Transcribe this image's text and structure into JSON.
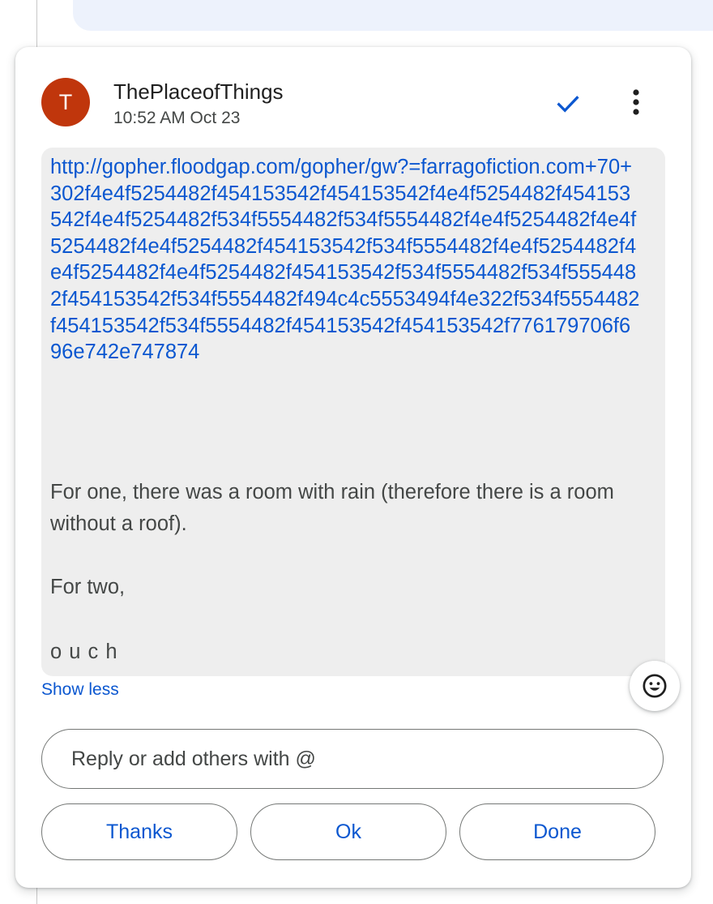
{
  "comment": {
    "avatar_initial": "T",
    "avatar_color": "#c0360c",
    "author": "ThePlaceofThings",
    "timestamp": "10:52 AM Oct 23",
    "resolve_icon": "check-icon",
    "more_icon": "more-vert-icon",
    "link_text": "http://gopher.floodgap.com/gopher/gw?=farragofiction.com+70+302f4e4f5254482f454153542f454153542f4e4f5254482f454153542f4e4f5254482f534f5554482f534f5554482f4e4f5254482f4e4f5254482f4e4f5254482f454153542f534f5554482f4e4f5254482f4e4f5254482f4e4f5254482f454153542f534f5554482f534f5554482f454153542f534f5554482f494c4c5553494f4e322f534f5554482f454153542f534f5554482f454153542f454153542f776179706f696e742e747874",
    "paragraph_1": "For one, there was a room with rain (therefore there is a room without a roof).",
    "paragraph_2": "For two,",
    "paragraph_3": "o u c h",
    "show_less_label": "Show less"
  },
  "reactions": {
    "emoji_icon": "smiley-icon"
  },
  "reply": {
    "placeholder": "Reply or add others with @"
  },
  "quick_replies": [
    "Thanks",
    "Ok",
    "Done"
  ],
  "colors": {
    "accent": "#0b57d0",
    "body_background": "#eeeeee"
  }
}
